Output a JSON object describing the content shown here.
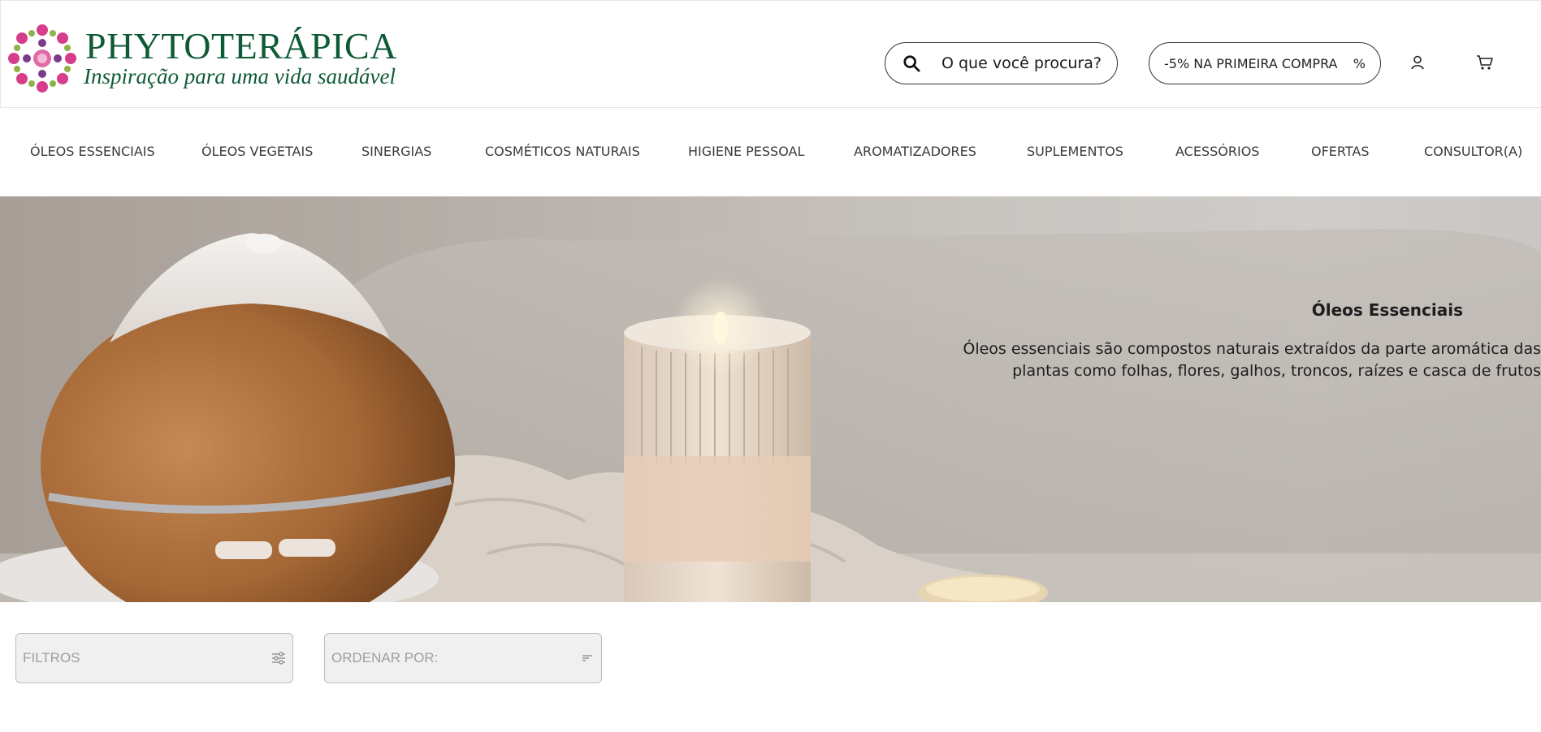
{
  "brand": {
    "name": "PHYTOTERÁPICA",
    "tagline": "Inspiração para uma vida saudável",
    "color": "#0e5a36"
  },
  "search": {
    "placeholder": "O que você procura?",
    "icon": "search-icon"
  },
  "promo": {
    "label": "-5% NA PRIMEIRA COMPRA",
    "suffix": "%"
  },
  "header_icons": [
    "user-icon",
    "cart-icon"
  ],
  "nav": {
    "items": [
      {
        "label": "ÓLEOS ESSENCIAIS"
      },
      {
        "label": "ÓLEOS VEGETAIS"
      },
      {
        "label": "SINERGIAS"
      },
      {
        "label": "COSMÉTICOS NATURAIS"
      },
      {
        "label": "HIGIENE PESSOAL"
      },
      {
        "label": "AROMATIZADORES"
      },
      {
        "label": "SUPLEMENTOS"
      },
      {
        "label": "ACESSÓRIOS"
      },
      {
        "label": "OFERTAS"
      },
      {
        "label": "CONSULTOR(A)"
      }
    ]
  },
  "hero": {
    "title": "Óleos Essenciais",
    "description": "Óleos essenciais são compostos naturais extraídos da parte aromática das plantas como folhas, flores, galhos, troncos, raízes e casca de frutos"
  },
  "toolbar": {
    "filters_label": "FILTROS",
    "filters_icon": "sliders-icon",
    "sort_label": "ORDENAR POR:",
    "sort_icon": "sort-icon"
  }
}
